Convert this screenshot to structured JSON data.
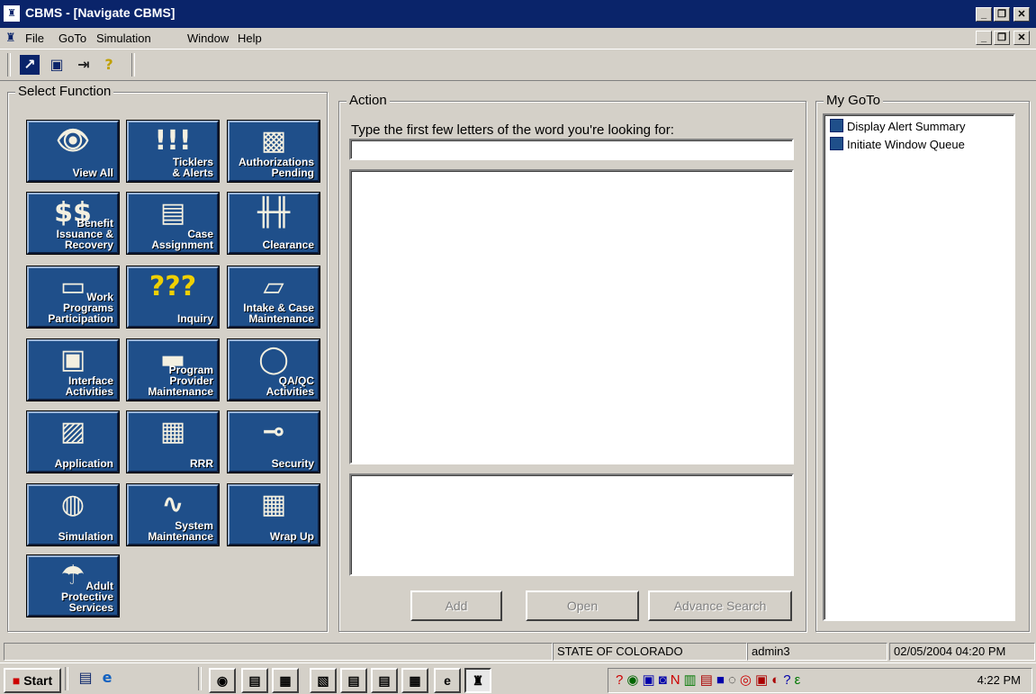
{
  "window": {
    "title": "CBMS - [Navigate CBMS]"
  },
  "menu": {
    "items": [
      {
        "label": "File"
      },
      {
        "label": "GoTo"
      },
      {
        "label": "Simulation"
      },
      {
        "label": "Window"
      },
      {
        "label": "Help"
      }
    ]
  },
  "select_function": {
    "legend": "Select Function",
    "tiles": [
      {
        "label": "View All",
        "icon": "eye-icon"
      },
      {
        "label": "Ticklers\n& Alerts",
        "icon": "alert-icon"
      },
      {
        "label": "Authorizations\nPending",
        "icon": "stamp-icon"
      },
      {
        "label": "Benefit\nIssuance &\nRecovery",
        "icon": "money-icon"
      },
      {
        "label": "Case\nAssignment",
        "icon": "clipboard-icon"
      },
      {
        "label": "Clearance",
        "icon": "fence-icon"
      },
      {
        "label": "Work\nPrograms\nParticipation",
        "icon": "documents-icon"
      },
      {
        "label": "Inquiry",
        "icon": "question-icon"
      },
      {
        "label": "Intake & Case\nMaintenance",
        "icon": "folder-icon"
      },
      {
        "label": "Interface\nActivities",
        "icon": "computer-icon"
      },
      {
        "label": "Program\nProvider\nMaintenance",
        "icon": "briefcase-icon"
      },
      {
        "label": "QA/QC\nActivities",
        "icon": "magnifier-icon"
      },
      {
        "label": "Application",
        "icon": "papers-icon"
      },
      {
        "label": "RRR",
        "icon": "printer-icon"
      },
      {
        "label": "Security",
        "icon": "key-icon"
      },
      {
        "label": "Simulation",
        "icon": "projector-icon"
      },
      {
        "label": "System\nMaintenance",
        "icon": "chart-icon"
      },
      {
        "label": "Wrap Up",
        "icon": "boxes-icon"
      },
      {
        "label": "Adult\nProtective\nServices",
        "icon": "umbrella-icon"
      }
    ]
  },
  "action": {
    "legend": "Action",
    "prompt": "Type the first few letters of the word you're looking for:",
    "search_value": "",
    "buttons": {
      "add": "Add",
      "open": "Open",
      "advance_search": "Advance Search"
    }
  },
  "goto": {
    "legend": "My GoTo",
    "items": [
      "Display Alert Summary",
      "Initiate Window Queue"
    ]
  },
  "status": {
    "state": "STATE OF COLORADO",
    "user": "admin3",
    "datetime": "02/05/2004 04:20 PM"
  },
  "taskbar": {
    "start": "Start",
    "clock": "4:22 PM"
  }
}
